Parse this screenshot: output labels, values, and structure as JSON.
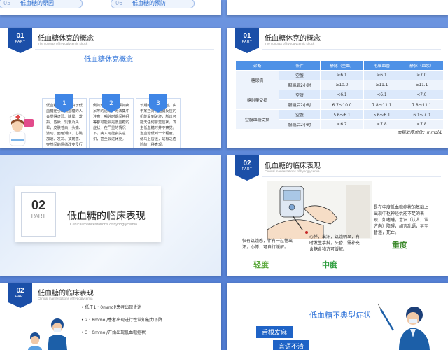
{
  "top_strip": {
    "pill1_num": "05",
    "pill1_label": "低血糖的原因",
    "pill2_num": "06",
    "pill2_label": "低血糖的预防"
  },
  "s1": {
    "part_num": "01",
    "part_lbl": "PART",
    "title": "低血糖休克的概念",
    "subtitle": "The concept of hypoglycemic shock",
    "heading": "低血糖休克概念",
    "cards": [
      {
        "num": "1",
        "text": "低血糖休克常常由于低血糖症引发低血糖的人会觉得虚弱、眩晕、发抖、昏厥、饥饿及头晕，皮肤苍白，头痛、激动、面色潮红、心跳加速、发冷、抽筋感、突然间的情绪改变及行为改变。"
      },
      {
        "num": "2",
        "text": "例如无车灾治、呆如痴呆等的活动。无法集中注意，喝醉时期间神经等都可能会是低血糖的症状，在严重的情况下，病人可能丧失意识，甚至会进休克。"
      },
      {
        "num": "3",
        "text": "长期的糖尿病患者，由于某些对低血糖反应的机能受到破坏，所以可能无任何警觉症状，发生低血糖时并不察觉。当血糖低到一个程度，便马上昏迷，是极之危险的一种表现。"
      }
    ]
  },
  "s2": {
    "part_num": "01",
    "part_lbl": "PART",
    "title": "低血糖休克的概念",
    "subtitle": "The concept of hypoglycemic shock",
    "headers": [
      "诊断",
      "条件",
      "静脉（全血）",
      "毛细血管",
      "静脉（血浆）"
    ],
    "rows": [
      [
        "糖尿病",
        "空腹",
        "≥6.1",
        "≥6.1",
        "≥7.0"
      ],
      [
        "",
        "服糖后2小时",
        "≥10.0",
        "≥11.1",
        "≥11.1"
      ],
      [
        "糖耐量受损",
        "空腹",
        "<6.1",
        "<6.1",
        "<7.0"
      ],
      [
        "",
        "服糖后2小时",
        "6.7～10.0",
        "7.8～11.1",
        "7.8～11.1"
      ],
      [
        "空腹血糖受损",
        "空腹",
        "5.6～6.1",
        "5.6～6.1",
        "6.1～7.0"
      ],
      [
        "",
        "服糖后2小时",
        "<6.7",
        "<7.8",
        "<7.8"
      ]
    ],
    "unit_note": "血糖浓度单位：mmol/L"
  },
  "s3": {
    "part_num": "02",
    "part_lbl": "PART",
    "title": "低血糖的临床表现",
    "subtitle": "Clinical manifestations of hypoglycemia"
  },
  "s4": {
    "part_num": "02",
    "part_lbl": "PART",
    "title": "低血糖的临床表现",
    "subtitle": "Clinical manifestations of hypoglycemia",
    "mild_text": "仅有饥饿感，伴有一过性出汗，心悸，可自行缓解。",
    "mild_label": "轻度",
    "moderate_text": "心悸，出汗，饥饿明显，有时发生手抖，头昏，需补充含糖食物方可缓解。",
    "moderate_label": "中度",
    "severe_text": "是在中度低血糖症状的基础上出现中枢神经供能不足的表现，如嗜睡，意识（认人，认方向）障碍，胡言乱语，甚至昏迷，死亡。",
    "severe_label": "重度"
  },
  "s5": {
    "part_num": "02",
    "part_lbl": "PART",
    "title": "低血糖的临床表现",
    "subtitle": "Clinical manifestations of hypoglycemia",
    "items": [
      "低于1・0mmol/患者出现昏迷",
      "2・8mmol/患者出现进行性认知能力下降",
      "3・0mmol/开始出现低血糖症状"
    ]
  },
  "s6": {
    "heading": "低血糖不典型症状",
    "tags": [
      "舌根发麻",
      "言语不清"
    ]
  },
  "colors": {
    "brand_dark": "#1b4fa8",
    "brand": "#3f86e6",
    "mild": "#5aa83a",
    "moderate": "#2e9e3e",
    "severe": "#3f8b2e"
  }
}
